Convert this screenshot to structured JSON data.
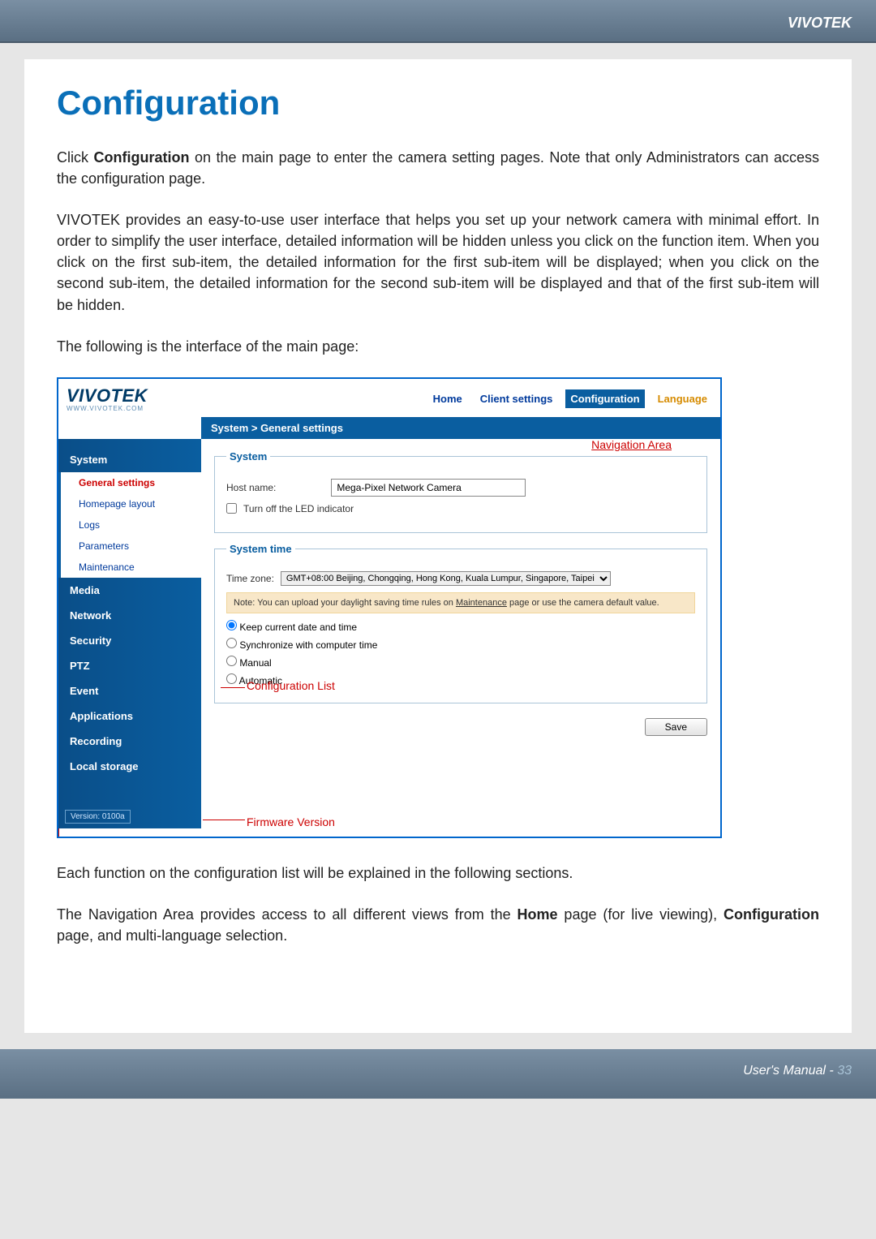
{
  "header": {
    "brand": "VIVOTEK"
  },
  "title": "Configuration",
  "para1": {
    "pre": "Click ",
    "bold": "Configuration",
    "post": " on the main page to enter the camera setting pages. Note that only Administrators can access the configuration page."
  },
  "para2": "VIVOTEK provides an easy-to-use user interface that helps you set up your network camera with minimal effort. In order to simplify the user interface, detailed information will be hidden unless you click on the function item. When you click on the first sub-item, the detailed information for the first sub-item will be displayed; when you click on the second sub-item, the detailed information for the second sub-item will be displayed and that of the first sub-item will be hidden.",
  "para3": "The following is the interface of the main page:",
  "ui": {
    "logo": "VIVOTEK",
    "logo_sub": "WWW.VIVOTEK.COM",
    "nav": {
      "home": "Home",
      "client": "Client settings",
      "config": "Configuration",
      "lang": "Language"
    },
    "breadcrumb": "System  >  General settings",
    "sidebar": {
      "system": "System",
      "subs": {
        "general": "General settings",
        "homepage": "Homepage layout",
        "logs": "Logs",
        "params": "Parameters",
        "maint": "Maintenance"
      },
      "media": "Media",
      "network": "Network",
      "security": "Security",
      "ptz": "PTZ",
      "event": "Event",
      "apps": "Applications",
      "recording": "Recording",
      "local": "Local storage"
    },
    "version": "Version: 0100a",
    "main": {
      "system_legend": "System",
      "host_label": "Host name:",
      "host_value": "Mega-Pixel Network Camera",
      "led_label": "Turn off the LED indicator",
      "time_legend": "System time",
      "tz_label": "Time zone:",
      "tz_value": "GMT+08:00 Beijing, Chongqing, Hong Kong, Kuala Lumpur, Singapore, Taipei",
      "note_pre": "Note: You can upload your daylight saving time rules on ",
      "note_link": "Maintenance",
      "note_post": " page or use the camera default value.",
      "radio_keep": "Keep current date and time",
      "radio_sync": "Synchronize with computer time",
      "radio_manual": "Manual",
      "radio_auto": "Automatic",
      "save": "Save"
    },
    "callouts": {
      "nav": "Navigation Area",
      "conf": "Configuration List",
      "ver": "Firmware Version"
    }
  },
  "para4": "Each function on the configuration list will be explained in the following sections.",
  "para5": {
    "pre": "The Navigation Area provides access to all different views from the ",
    "b1": "Home",
    "mid": " page (for live viewing), ",
    "b2": "Configuration",
    "post": " page, and multi-language selection."
  },
  "footer": {
    "label": "User's Manual - ",
    "page": "33"
  }
}
